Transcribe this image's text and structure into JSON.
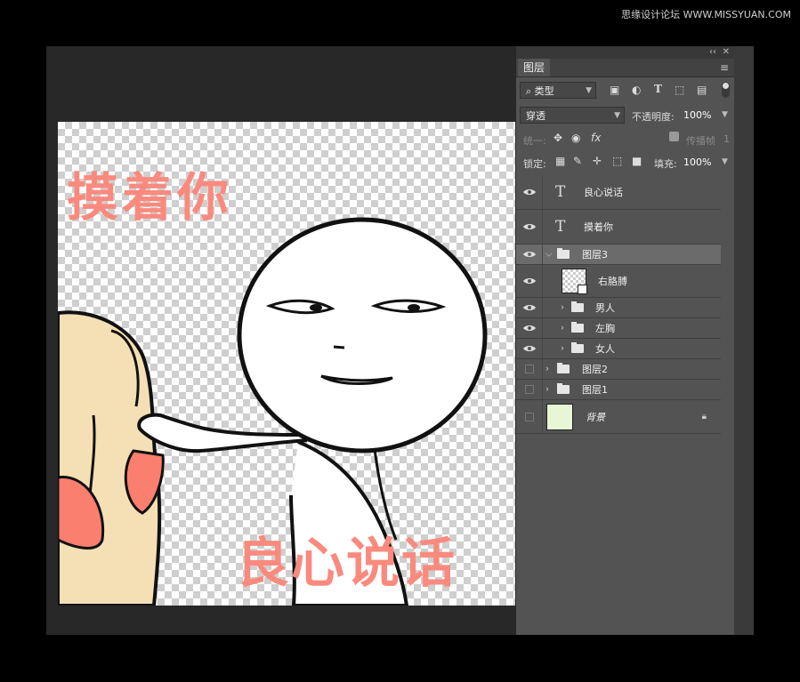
{
  "watermark": "思缘设计论坛 WWW.MISSYUAN.COM",
  "artwork": {
    "top_text": "摸着你",
    "bottom_text": "良心说话"
  },
  "panel": {
    "tab": "图层",
    "filter_label": "类型",
    "blend_mode": "穿透",
    "opacity_label": "不透明度:",
    "opacity_value": "100%",
    "unify_label": "统一:",
    "propagate_label": "传播帧",
    "propagate_value": "1",
    "lock_label": "锁定:",
    "fill_label": "填充:",
    "fill_value": "100%",
    "layers": [
      {
        "name": "良心说话",
        "kind": "text",
        "visible": true
      },
      {
        "name": "摸着你",
        "kind": "text",
        "visible": true
      },
      {
        "name": "图层3",
        "kind": "group-open",
        "visible": true,
        "selected": true
      },
      {
        "name": "右胳膊",
        "kind": "pixel",
        "visible": true
      },
      {
        "name": "男人",
        "kind": "group",
        "visible": true
      },
      {
        "name": "左胸",
        "kind": "group",
        "visible": true
      },
      {
        "name": "女人",
        "kind": "group",
        "visible": true
      },
      {
        "name": "图层2",
        "kind": "group",
        "visible": false
      },
      {
        "name": "图层1",
        "kind": "group",
        "visible": false
      },
      {
        "name": "背景",
        "kind": "background",
        "visible": false,
        "locked": true
      }
    ]
  }
}
